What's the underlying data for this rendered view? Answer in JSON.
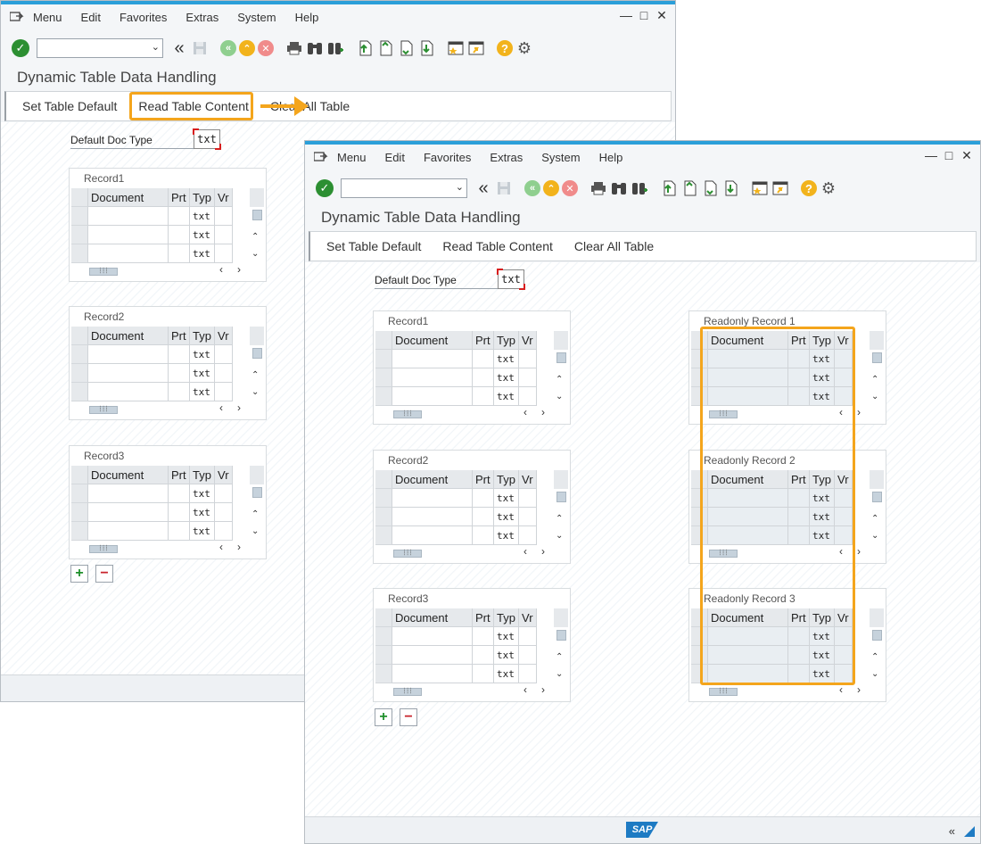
{
  "menu": [
    "Menu",
    "Edit",
    "Favorites",
    "Extras",
    "System",
    "Help"
  ],
  "window_controls": [
    "—",
    "□",
    "✕"
  ],
  "title": "Dynamic Table Data Handling",
  "app_toolbar": [
    "Set Table Default",
    "Read Table Content",
    "Clear All Table"
  ],
  "field": {
    "label": "Default Doc Type",
    "value": "txt"
  },
  "columns": [
    "Document",
    "Prt",
    "Typ",
    "Vr"
  ],
  "cell_typ": "txt",
  "back": {
    "groups": [
      "Record1",
      "Record2",
      "Record3"
    ]
  },
  "front": {
    "groups": [
      "Record1",
      "Record2",
      "Record3"
    ],
    "readonly_groups": [
      "Readonly Record 1",
      "Readonly Record 2",
      "Readonly Record 3"
    ]
  },
  "statusbar": {
    "logo": "SAP",
    "right": "«"
  },
  "colors": {
    "accent": "#f4a51c",
    "titlebar": "#2b9fd9",
    "ok": "#2c8f32",
    "add": "#1e8f2a",
    "delete": "#c8232c"
  },
  "icons": [
    "menu-icon",
    "ok-icon",
    "back-icon",
    "save-icon",
    "previous-icon",
    "exit-icon",
    "cancel-icon",
    "print-icon",
    "find-icon",
    "find-next-icon",
    "first-page-icon",
    "previous-page-icon",
    "next-page-icon",
    "last-page-icon",
    "create-session-icon",
    "shortcut-icon",
    "help-icon",
    "settings-icon"
  ]
}
